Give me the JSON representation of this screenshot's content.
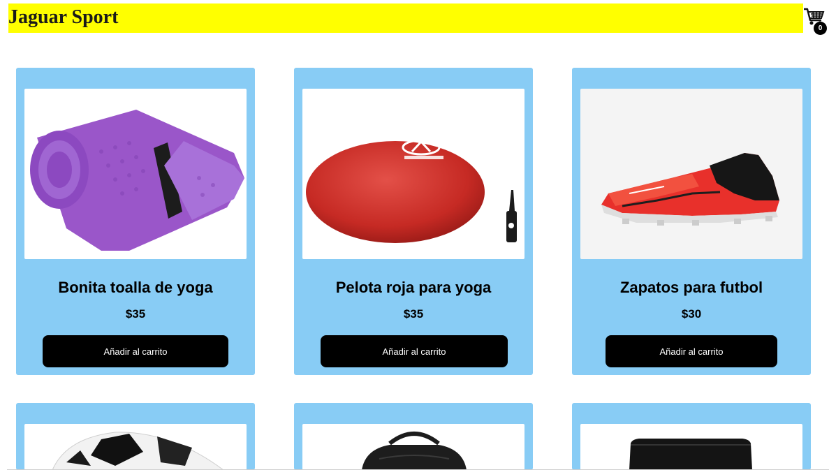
{
  "header": {
    "brand": "Jaguar Sport",
    "cart_count": "0"
  },
  "products": [
    {
      "name": "Bonita toalla de yoga",
      "price": "$35",
      "button": "Añadir al carrito",
      "image": "purple-yoga-towel"
    },
    {
      "name": "Pelota roja para yoga",
      "price": "$35",
      "button": "Añadir al carrito",
      "image": "red-yoga-ball"
    },
    {
      "name": "Zapatos para futbol",
      "price": "$30",
      "button": "Añadir al carrito",
      "image": "red-football-boot"
    }
  ],
  "products_partial": [
    {
      "image": "soccer-ball"
    },
    {
      "image": "black-backpack"
    },
    {
      "image": "black-bag"
    }
  ]
}
